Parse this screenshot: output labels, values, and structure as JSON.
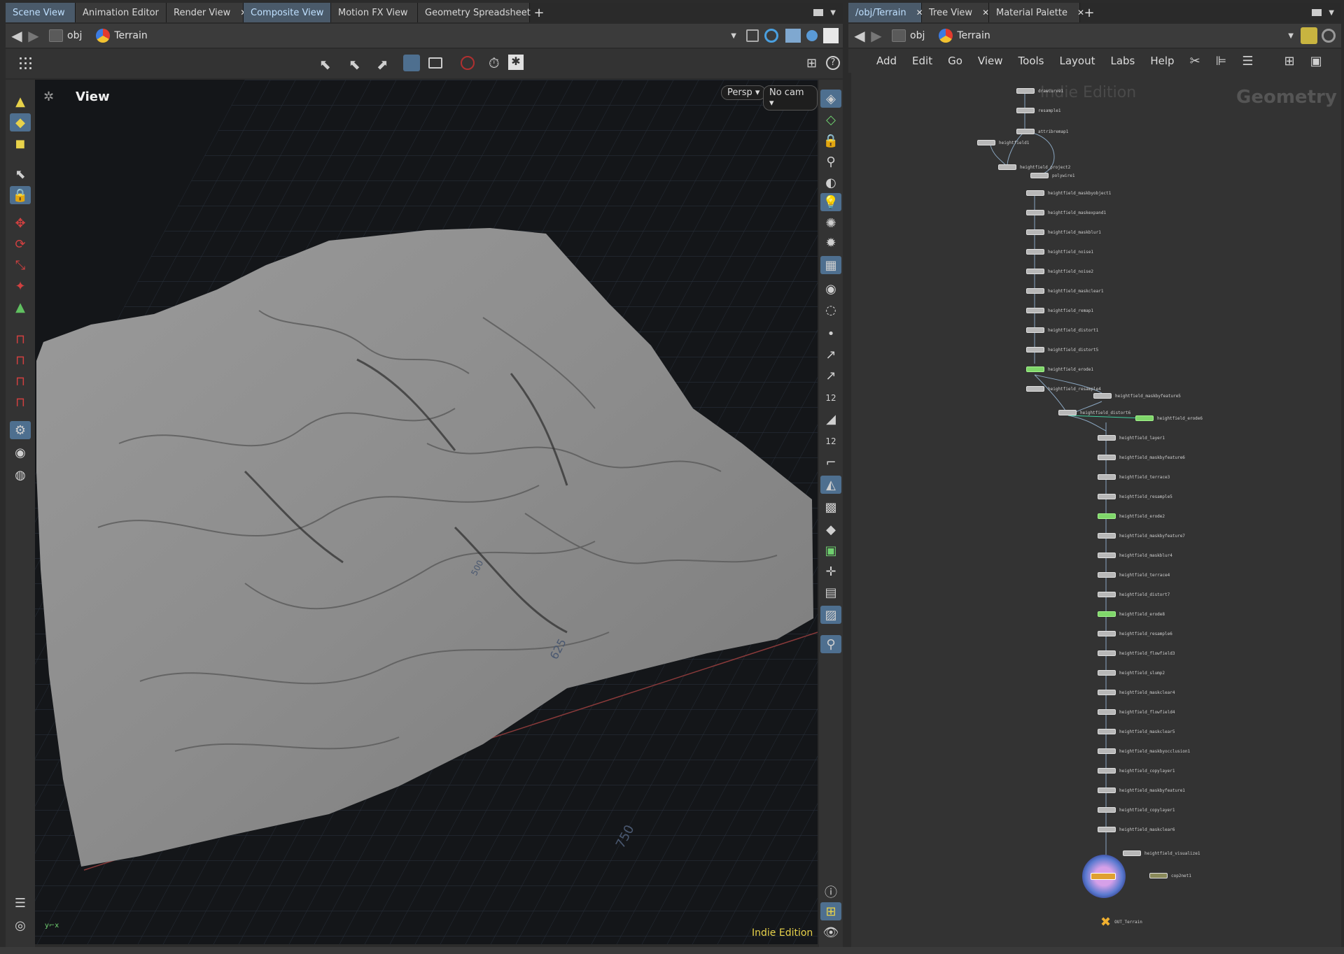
{
  "left_tabs": [
    "Scene View",
    "Animation Editor",
    "Render View",
    "Composite View",
    "Motion FX View",
    "Geometry Spreadsheet"
  ],
  "right_tabs": [
    "/obj/Terrain",
    "Tree View",
    "Material Palette"
  ],
  "path": {
    "level": "obj",
    "node": "Terrain"
  },
  "viewport": {
    "title": "View",
    "camera_mode": "Persp",
    "camera": "No cam",
    "grid_labels": [
      "500",
      "625",
      "750"
    ],
    "edition": "Indie Edition"
  },
  "network": {
    "menu": [
      "Add",
      "Edit",
      "Go",
      "View",
      "Tools",
      "Layout",
      "Labs",
      "Help"
    ],
    "watermark": "Indie Edition",
    "context": "Geometry",
    "nodes": [
      "drawcurve1",
      "resample1",
      "attribremap1",
      "heightfield1",
      "heightfield_project2",
      "polywire1",
      "heightfield_maskbyobject1",
      "heightfield_maskexpand1",
      "heightfield_maskblur1",
      "heightfield_noise1",
      "heightfield_noise2",
      "heightfield_maskclear1",
      "heightfield_remap1",
      "heightfield_distort1",
      "heightfield_distort5",
      "heightfield_erode1",
      "heightfield_resample4",
      "heightfield_maskbyfeature5",
      "heightfield_distort6",
      "heightfield_erode6",
      "heightfield_layer1",
      "heightfield_maskbyfeature6",
      "heightfield_terrace3",
      "heightfield_resample5",
      "heightfield_erode2",
      "heightfield_maskbyfeature7",
      "heightfield_maskblur4",
      "heightfield_terrace4",
      "heightfield_distort7",
      "heightfield_erode8",
      "heightfield_resample6",
      "heightfield_flowfield3",
      "heightfield_slump2",
      "heightfield_maskclear4",
      "heightfield_flowfield4",
      "heightfield_maskclear5",
      "heightfield_maskbyocclusion1",
      "heightfield_copylayer1",
      "heightfield_maskbyfeature1",
      "heightfield_copylayer1",
      "heightfield_maskclear6",
      "heightfield_visualize1",
      "cop2net1",
      "OUT_Terrain"
    ]
  }
}
